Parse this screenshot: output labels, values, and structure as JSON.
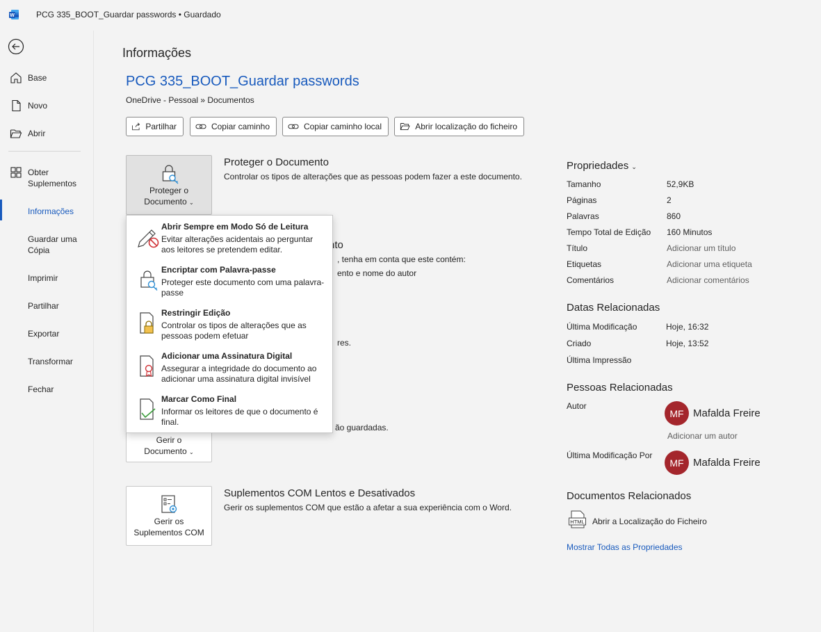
{
  "titlebar": {
    "title": "PCG 335_BOOT_Guardar passwords  •  Guardado"
  },
  "nav": {
    "items": [
      {
        "label": "Base"
      },
      {
        "label": "Novo"
      },
      {
        "label": "Abrir"
      },
      {
        "label": "Obter Suplementos"
      },
      {
        "label": "Informações"
      },
      {
        "label": "Guardar uma Cópia"
      },
      {
        "label": "Imprimir"
      },
      {
        "label": "Partilhar"
      },
      {
        "label": "Exportar"
      },
      {
        "label": "Transformar"
      },
      {
        "label": "Fechar"
      }
    ],
    "active": "Informações"
  },
  "main": {
    "page_title": "Informações",
    "doc_name": "PCG 335_BOOT_Guardar passwords",
    "doc_path": "OneDrive - Pessoal » Documentos",
    "buttons": {
      "share": "Partilhar",
      "copy_path": "Copiar caminho",
      "copy_local_path": "Copiar caminho local",
      "open_location": "Abrir localização do ficheiro"
    },
    "protect": {
      "tile_line1": "Proteger o",
      "tile_line2": "Documento",
      "title": "Proteger o Documento",
      "desc": "Controlar os tipos de alterações que as pessoas podem fazer a este documento."
    },
    "inspect": {
      "title_partial": "nto",
      "desc_line1": ", tenha em conta que este contém:",
      "desc_line2": "ento e nome do autor",
      "desc_line3": "res."
    },
    "manage": {
      "tile_line1": "Gerir o",
      "tile_line2": "Documento",
      "desc_partial": "ão guardadas."
    },
    "com": {
      "tile_line1": "Gerir os",
      "tile_line2": "Suplementos COM",
      "title": "Suplementos COM Lentos e Desativados",
      "desc": "Gerir os suplementos COM que estão a afetar a sua experiência com o Word."
    }
  },
  "menu": {
    "items": [
      {
        "title": "Abrir Sempre em Modo Só de Leitura",
        "desc": "Evitar alterações acidentais ao perguntar aos leitores se pretendem editar.",
        "icon": "pencil-prohibited-icon"
      },
      {
        "title": "Encriptar com Palavra-passe",
        "desc": "Proteger este documento com uma palavra-passe",
        "icon": "lock-key-icon"
      },
      {
        "title": "Restringir Edição",
        "desc": "Controlar os tipos de alterações que as pessoas podem efetuar",
        "icon": "document-lock-icon"
      },
      {
        "title": "Adicionar uma Assinatura Digital",
        "desc": "Assegurar a integridade do documento ao adicionar uma assinatura digital invisível",
        "icon": "document-ribbon-icon"
      },
      {
        "title": "Marcar Como Final",
        "desc": "Informar os leitores de que o documento é final.",
        "icon": "document-check-icon"
      }
    ]
  },
  "properties": {
    "title": "Propriedades",
    "rows": [
      {
        "key": "Tamanho",
        "value": "52,9KB"
      },
      {
        "key": "Páginas",
        "value": "2"
      },
      {
        "key": "Palavras",
        "value": "860"
      },
      {
        "key": "Tempo Total de Edição",
        "value": "160 Minutos"
      },
      {
        "key": "Título",
        "value": "Adicionar um título"
      },
      {
        "key": "Etiquetas",
        "value": "Adicionar uma etiqueta"
      },
      {
        "key": "Comentários",
        "value": "Adicionar comentários"
      }
    ],
    "dates_title": "Datas Relacionadas",
    "dates": [
      {
        "key": "Última Modificação",
        "value": "Hoje, 16:32"
      },
      {
        "key": "Criado",
        "value": "Hoje, 13:52"
      },
      {
        "key": "Última Impressão",
        "value": ""
      }
    ],
    "people_title": "Pessoas Relacionadas",
    "author_label": "Autor",
    "author_initials": "MF",
    "author_name": "Mafalda Freire",
    "add_author": "Adicionar um autor",
    "last_modified_by_label": "Última Modificação Por",
    "modifier_initials": "MF",
    "modifier_name": "Mafalda Freire",
    "related_docs_title": "Documentos Relacionados",
    "open_file_location": "Abrir a Localização do Ficheiro",
    "show_all": "Mostrar Todas as Propriedades"
  },
  "colors": {
    "accent": "#185abd",
    "avatar": "#a4262c"
  }
}
